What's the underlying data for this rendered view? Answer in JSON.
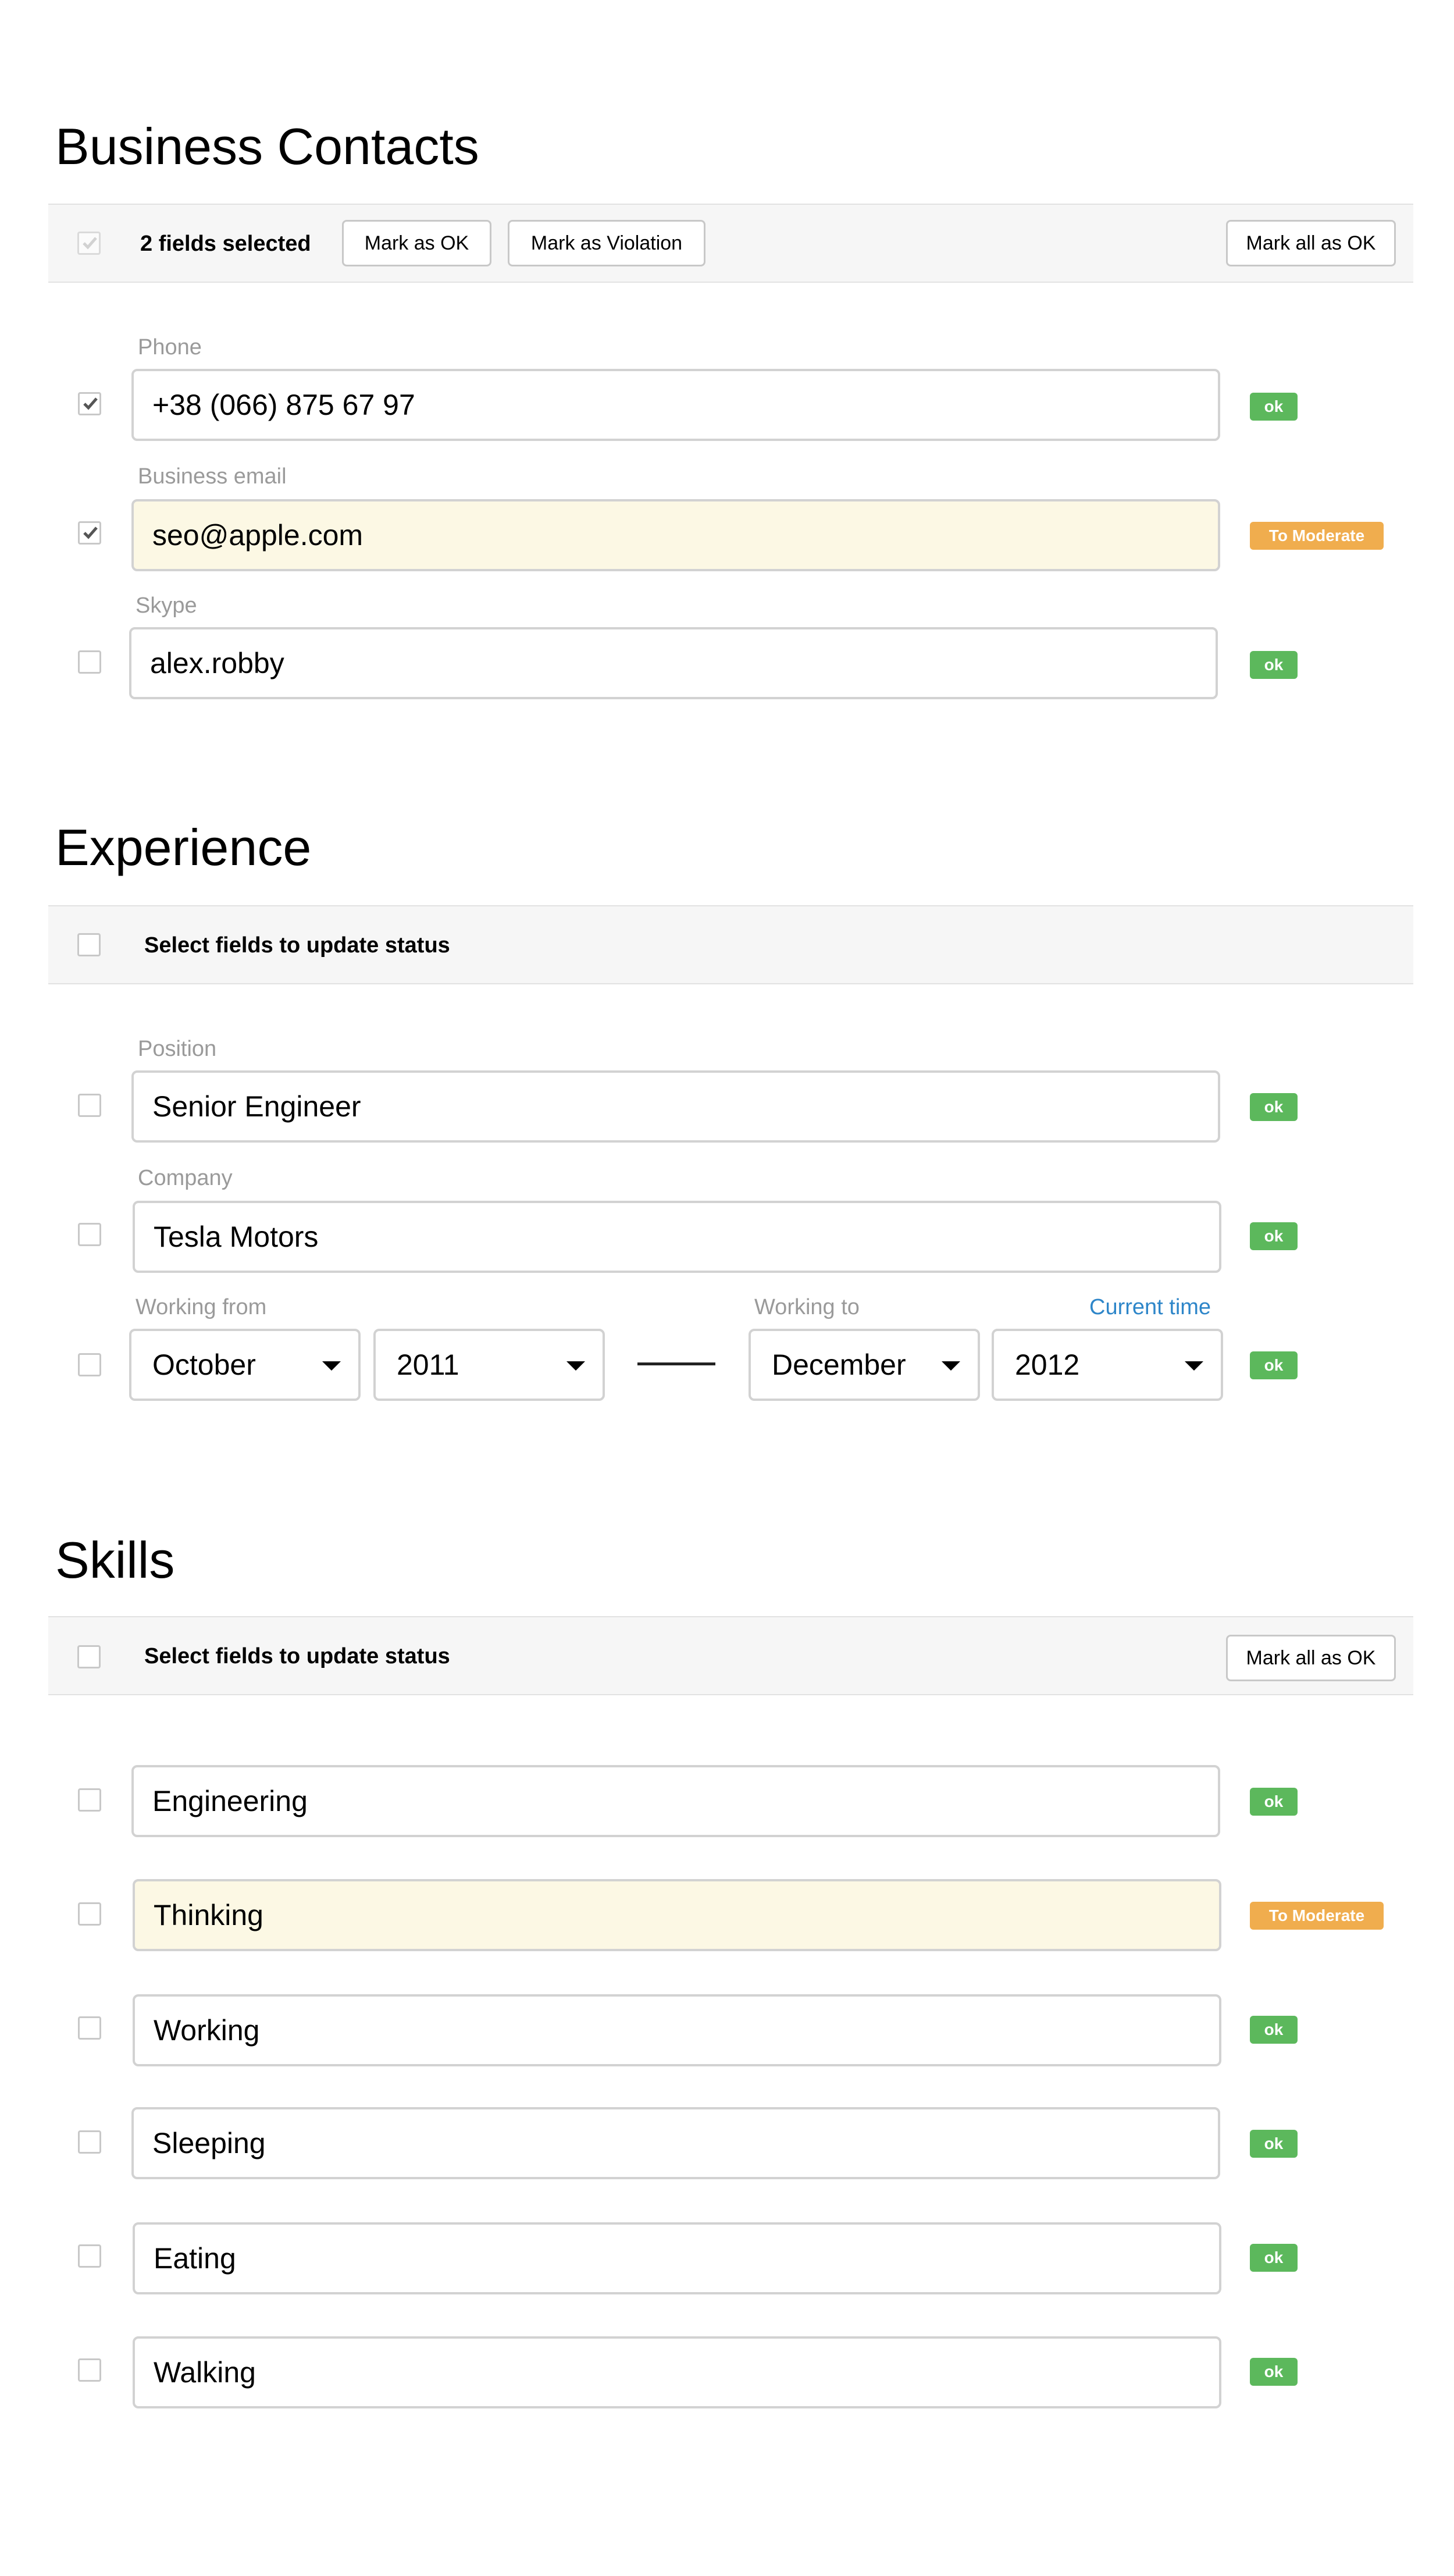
{
  "business_contacts": {
    "title": "Business Contacts",
    "toolbar": {
      "selected_text": "2 fields selected",
      "mark_ok": "Mark as OK",
      "mark_violation": "Mark as Violation",
      "mark_all_ok": "Mark all as OK"
    },
    "fields": [
      {
        "label": "Phone",
        "value": "+38 (066) 875 67 97",
        "checked": true,
        "status": "ok"
      },
      {
        "label": "Business email",
        "value": "seo@apple.com",
        "checked": true,
        "status": "To Moderate"
      },
      {
        "label": "Skype",
        "value": "alex.robby",
        "checked": false,
        "status": "ok"
      }
    ]
  },
  "experience": {
    "title": "Experience",
    "toolbar": {
      "prompt": "Select fields to update status"
    },
    "fields": [
      {
        "label": "Position",
        "value": "Senior Engineer",
        "status": "ok"
      },
      {
        "label": "Company",
        "value": "Tesla Motors",
        "status": "ok"
      }
    ],
    "period": {
      "from_label": "Working from",
      "to_label": "Working to",
      "current_time_link": "Current time",
      "from_month": "October",
      "from_year": "2011",
      "to_month": "December",
      "to_year": "2012",
      "status": "ok"
    }
  },
  "skills": {
    "title": "Skills",
    "toolbar": {
      "prompt": "Select fields to update status",
      "mark_all_ok": "Mark all as OK"
    },
    "items": [
      {
        "value": "Engineering",
        "status": "ok"
      },
      {
        "value": "Thinking",
        "status": "To Moderate"
      },
      {
        "value": "Working",
        "status": "ok"
      },
      {
        "value": "Sleeping",
        "status": "ok"
      },
      {
        "value": "Eating",
        "status": "ok"
      },
      {
        "value": "Walking",
        "status": "ok"
      }
    ]
  },
  "colors": {
    "ok_badge": "#5cb85c",
    "moderate_badge": "#f0ad4e",
    "moderate_field_bg": "#fcf8e4",
    "link": "#2e86c9"
  }
}
